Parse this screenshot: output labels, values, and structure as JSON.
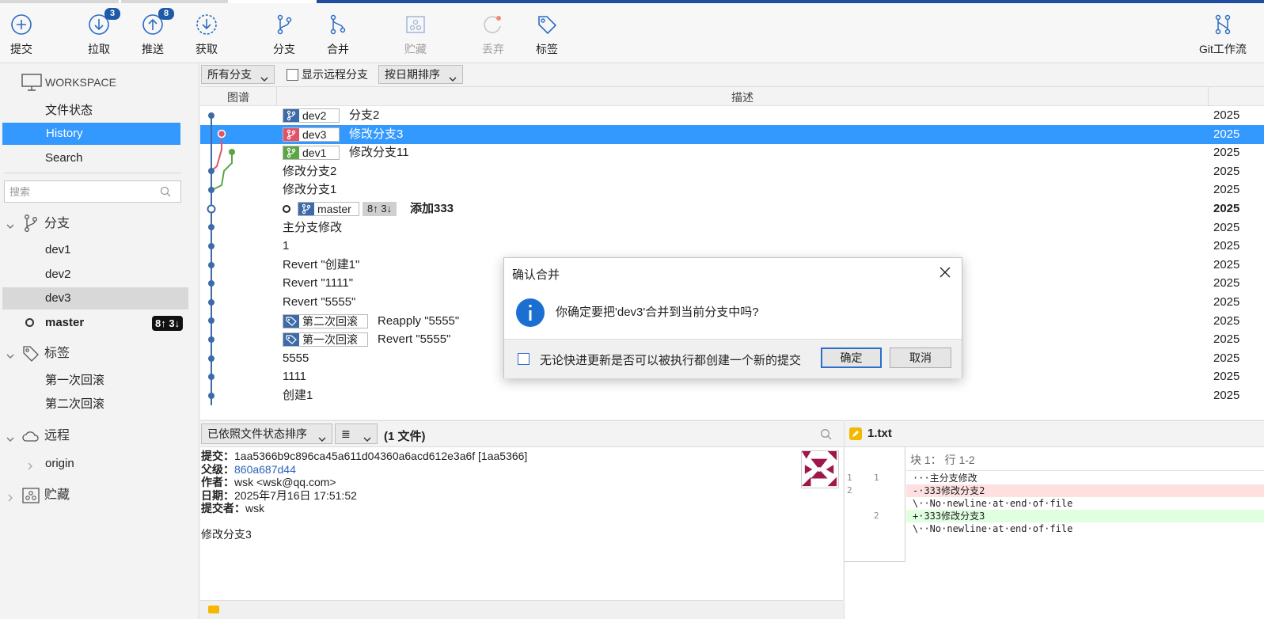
{
  "toolbar": {
    "commit": "提交",
    "pull": "拉取",
    "pull_badge": "3",
    "push": "推送",
    "push_badge": "8",
    "fetch": "获取",
    "branch": "分支",
    "merge": "合并",
    "stash": "贮藏",
    "discard": "丢弃",
    "tag": "标签",
    "gitflow": "Git工作流"
  },
  "sidebar": {
    "workspace": "WORKSPACE",
    "file_status": "文件状态",
    "history": "History",
    "search": "Search",
    "search_placeholder": "搜索",
    "branches_title": "分支",
    "branches": [
      "dev1",
      "dev2",
      "dev3",
      "master"
    ],
    "master_badge": "8↑ 3↓",
    "tags_title": "标签",
    "tags": [
      "第一次回滚",
      "第二次回滚"
    ],
    "remotes_title": "远程",
    "remotes": [
      "origin"
    ],
    "stash_title": "贮藏"
  },
  "filter": {
    "all_branches": "所有分支",
    "show_remote": "显示远程分支",
    "sort_by_date": "按日期排序"
  },
  "history": {
    "col_graph": "图谱",
    "col_desc": "描述",
    "rows": [
      {
        "branch": "dev2",
        "desc": "分支2",
        "date": "2025"
      },
      {
        "branch": "dev3",
        "desc": "修改分支3",
        "date": "2025"
      },
      {
        "branch": "dev1",
        "desc": "修改分支11",
        "date": "2025"
      },
      {
        "desc": "修改分支2",
        "date": "2025"
      },
      {
        "desc": "修改分支1",
        "date": "2025"
      },
      {
        "branch": "master",
        "ahead": "8↑ 3↓",
        "desc": "添加333",
        "date": "2025"
      },
      {
        "desc": "主分支修改",
        "date": "2025"
      },
      {
        "desc": "1",
        "date": "2025"
      },
      {
        "desc": "Revert \"创建1\"",
        "date": "2025"
      },
      {
        "desc": "Revert \"1111\"",
        "date": "2025"
      },
      {
        "desc": "Revert \"5555\"",
        "date": "2025"
      },
      {
        "tag": "第二次回滚",
        "desc": "Reapply \"5555\"",
        "date": "2025"
      },
      {
        "tag": "第一次回滚",
        "desc": "Revert \"5555\"",
        "date": "2025"
      },
      {
        "desc": "5555",
        "date": "2025"
      },
      {
        "desc": "1111",
        "date": "2025"
      },
      {
        "desc": "创建1",
        "date": "2025"
      }
    ]
  },
  "file_panel": {
    "sort_label": "已依照文件状态排序",
    "view_icon": "≣",
    "file_count": "(1 文件)"
  },
  "commit_details": {
    "commit_label": "提交：",
    "commit_value": "1aa5366b9c896ca45a611d04360a6acd612e3a6f [1aa5366]",
    "parent_label": "父级：",
    "parent_value": "860a687d44",
    "author_label": "作者：",
    "author_value": "wsk <wsk@qq.com>",
    "date_label": "日期：",
    "date_value": "2025年7月16日 17:51:52",
    "committer_label": "提交者：",
    "committer_value": "wsk",
    "message": "修改分支3"
  },
  "diff": {
    "filename": "1.txt",
    "hunk": "块 1： 行 1-2",
    "lines": [
      {
        "old": "1",
        "new": "1",
        "text": "···主分支修改",
        "kind": "ctx"
      },
      {
        "old": "2",
        "new": "",
        "text": "-·333修改分支2",
        "kind": "del"
      },
      {
        "old": "",
        "new": "",
        "text": "\\··No·newline·at·end·of·file",
        "kind": "ctx"
      },
      {
        "old": "",
        "new": "2",
        "text": "+·333修改分支3",
        "kind": "add"
      },
      {
        "old": "",
        "new": "",
        "text": "\\··No·newline·at·end·of·file",
        "kind": "ctx"
      }
    ]
  },
  "dialog": {
    "title": "确认合并",
    "message": "你确定要把'dev3'合并到当前分支中吗?",
    "checkbox_label": "无论快进更新是否可以被执行都创建一个新的提交",
    "ok": "确定",
    "cancel": "取消"
  },
  "colors": {
    "accent": "#3399ff",
    "branch_blue": "#3d6aa8",
    "branch_red": "#e0546a",
    "branch_green": "#5aa544",
    "selection": "#3399ff"
  }
}
